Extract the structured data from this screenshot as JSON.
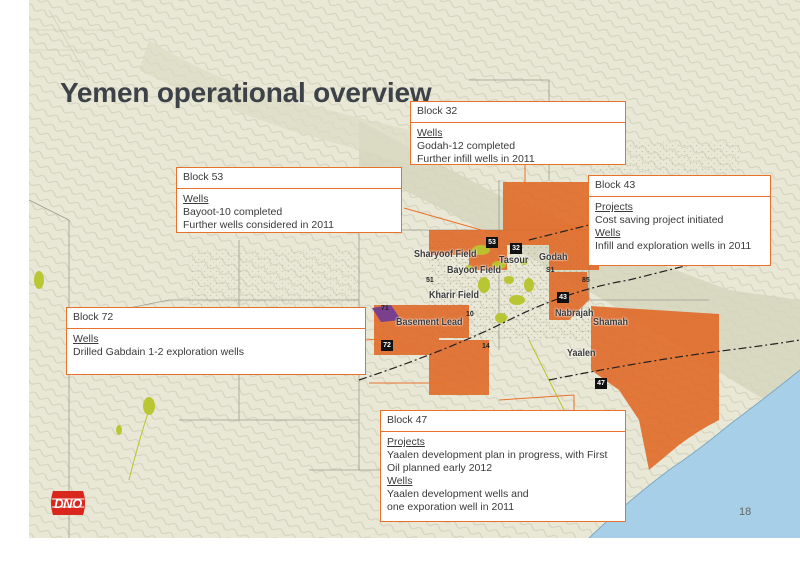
{
  "slide": {
    "title": "Yemen operational overview",
    "page_number": "18"
  },
  "logo": {
    "text": "DNO"
  },
  "map_labels": {
    "sharyoof": "Sharyoof Field",
    "tasour": "Tasour",
    "godah": "Godah",
    "bayoot": "Bayoot Field",
    "kharir": "Kharir Field",
    "basement": "Basement Lead",
    "nabrajah": "Nabrajah",
    "shamah": "Shamah",
    "yaalen": "Yaalen"
  },
  "block_numbers": [
    "53",
    "32",
    "43",
    "51",
    "10",
    "71",
    "72",
    "14",
    "47",
    "S1",
    "85"
  ],
  "callouts": {
    "block32": {
      "header": "Block 32",
      "wells_label": "Wells",
      "line1": "Godah-12 completed",
      "line2": "Further infill wells in 2011"
    },
    "block53": {
      "header": "Block 53",
      "wells_label": "Wells",
      "line1": "Bayoot-10 completed",
      "line2": "Further wells considered in 2011"
    },
    "block43": {
      "header": "Block 43",
      "projects_label": "Projects",
      "line1": "Cost saving project initiated",
      "wells_label": "Wells",
      "line2": "Infill and exploration wells in  2011"
    },
    "block72": {
      "header": "Block 72",
      "wells_label": "Wells",
      "line1": "Drilled Gabdain 1-2 exploration wells"
    },
    "block47": {
      "header": "Block 47",
      "projects_label": "Projects",
      "line1": "Yaalen development plan in progress, with First",
      "line2": "Oil planned early 2012",
      "wells_label": "Wells",
      "line3": "Yaalen development wells  and",
      "line4": "one exporation well in 2011"
    }
  },
  "colors": {
    "block_fill": "#e0631f",
    "callout_border": "#e8722a",
    "sea": "#a8cfe8",
    "terrain": "#e9e8d6",
    "field_green": "#b7c52c",
    "logo_red": "#d9271e",
    "title": "#3d4148"
  }
}
